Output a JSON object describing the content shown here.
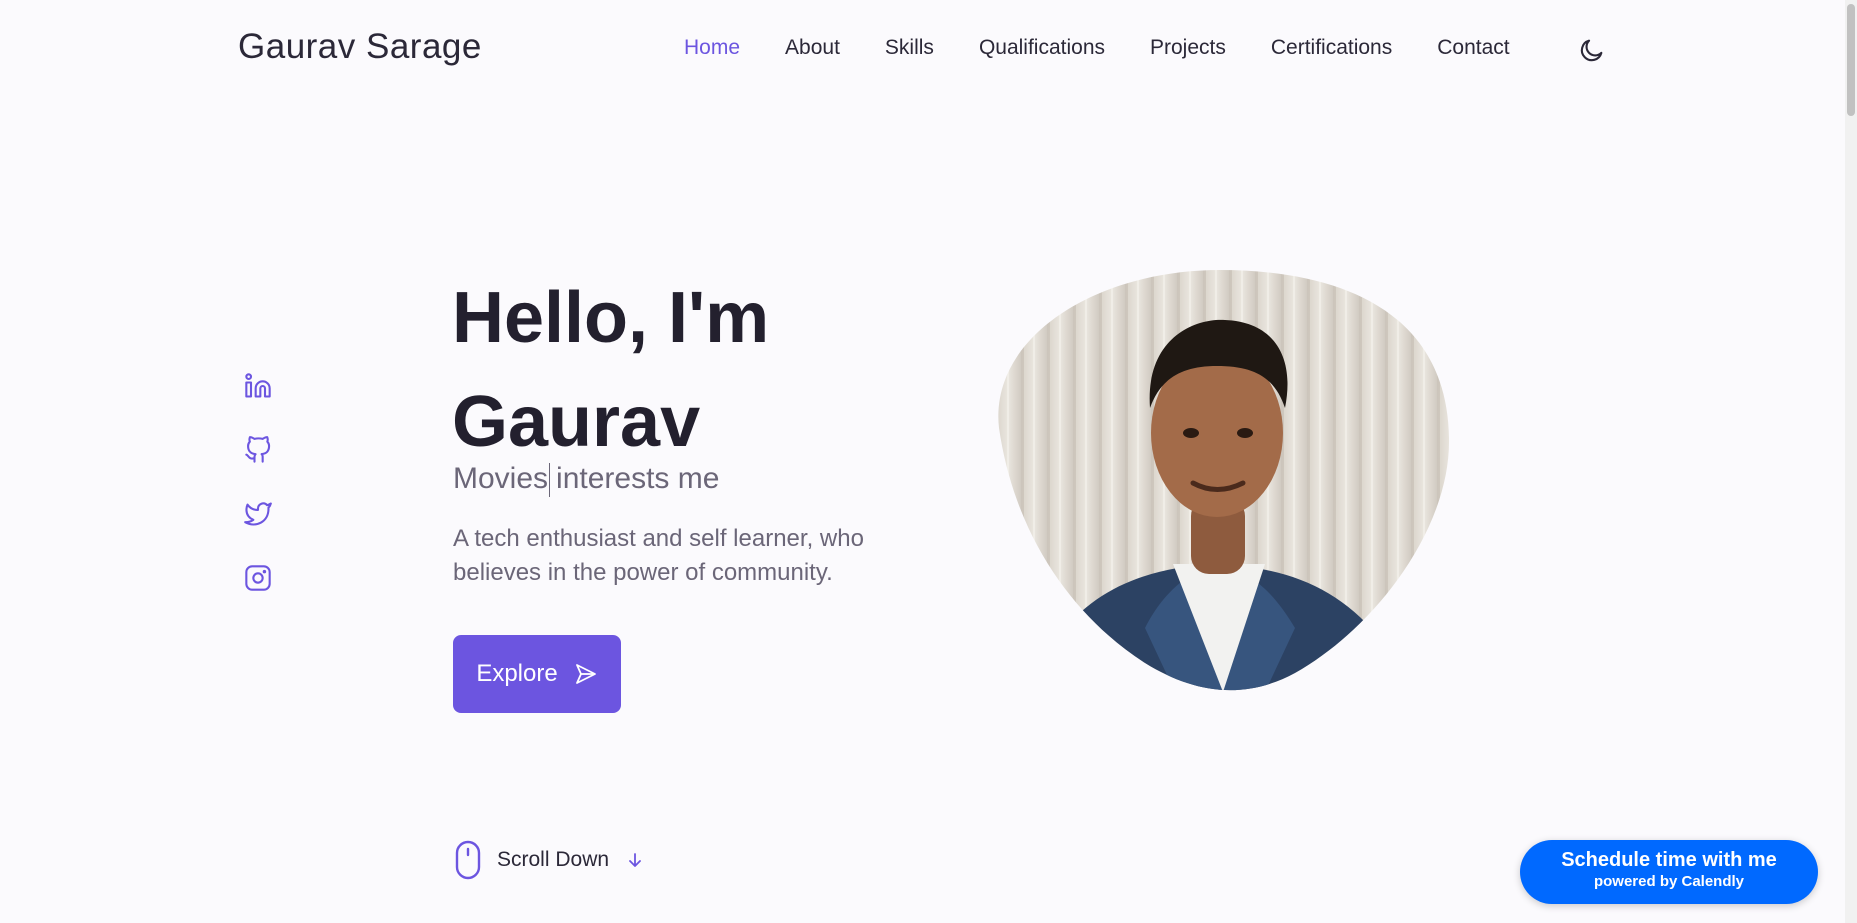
{
  "header": {
    "logo": "Gaurav Sarage",
    "nav": [
      "Home",
      "About",
      "Skills",
      "Qualifications",
      "Projects",
      "Certifications",
      "Contact"
    ],
    "active_nav": "Home",
    "theme_icon": "moon-icon"
  },
  "socials": [
    "linkedin-icon",
    "github-icon",
    "twitter-icon",
    "instagram-icon"
  ],
  "hero": {
    "title_line1": "Hello, I'm",
    "title_line2": "Gaurav",
    "typed_word": "Movies",
    "typed_suffix": "interests me",
    "description": "A tech enthusiast and self learner, who believes in the power of community.",
    "cta_label": "Explore",
    "cta_icon": "send-icon"
  },
  "scroll": {
    "label": "Scroll Down",
    "icon": "mouse-icon"
  },
  "calendly": {
    "title": "Schedule time with me",
    "subtitle": "powered by Calendly"
  },
  "colors": {
    "accent": "#6c55e0",
    "calendly": "#0069ff",
    "background": "#fbfafd"
  }
}
